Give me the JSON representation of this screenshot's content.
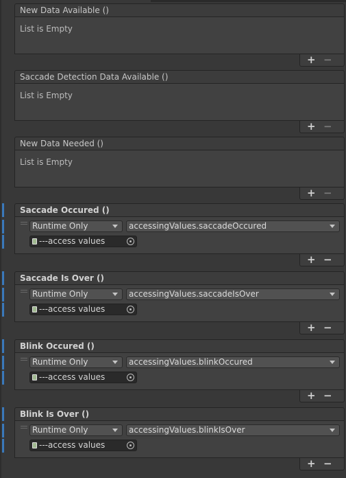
{
  "events": [
    {
      "title": "New Data Available ()",
      "empty_text": "List is Empty"
    },
    {
      "title": "Saccade Detection Data Available ()",
      "empty_text": "List is Empty"
    },
    {
      "title": "New Data Needed ()",
      "empty_text": "List is Empty"
    },
    {
      "title": "Saccade Occured ()",
      "runtime": "Runtime Only",
      "function": "accessingValues.saccadeOccured",
      "object": "---access values"
    },
    {
      "title": "Saccade Is Over ()",
      "runtime": "Runtime Only",
      "function": "accessingValues.saccadeIsOver",
      "object": "---access values"
    },
    {
      "title": "Blink Occured ()",
      "runtime": "Runtime Only",
      "function": "accessingValues.blinkOccured",
      "object": "---access values"
    },
    {
      "title": "Blink Is Over ()",
      "runtime": "Runtime Only",
      "function": "accessingValues.blinkIsOver",
      "object": "---access values"
    }
  ],
  "footer": {
    "add_label": "+",
    "remove_label": "−"
  },
  "colors": {
    "accent": "#3a79bb",
    "panel": "#414141",
    "background": "#383838"
  }
}
